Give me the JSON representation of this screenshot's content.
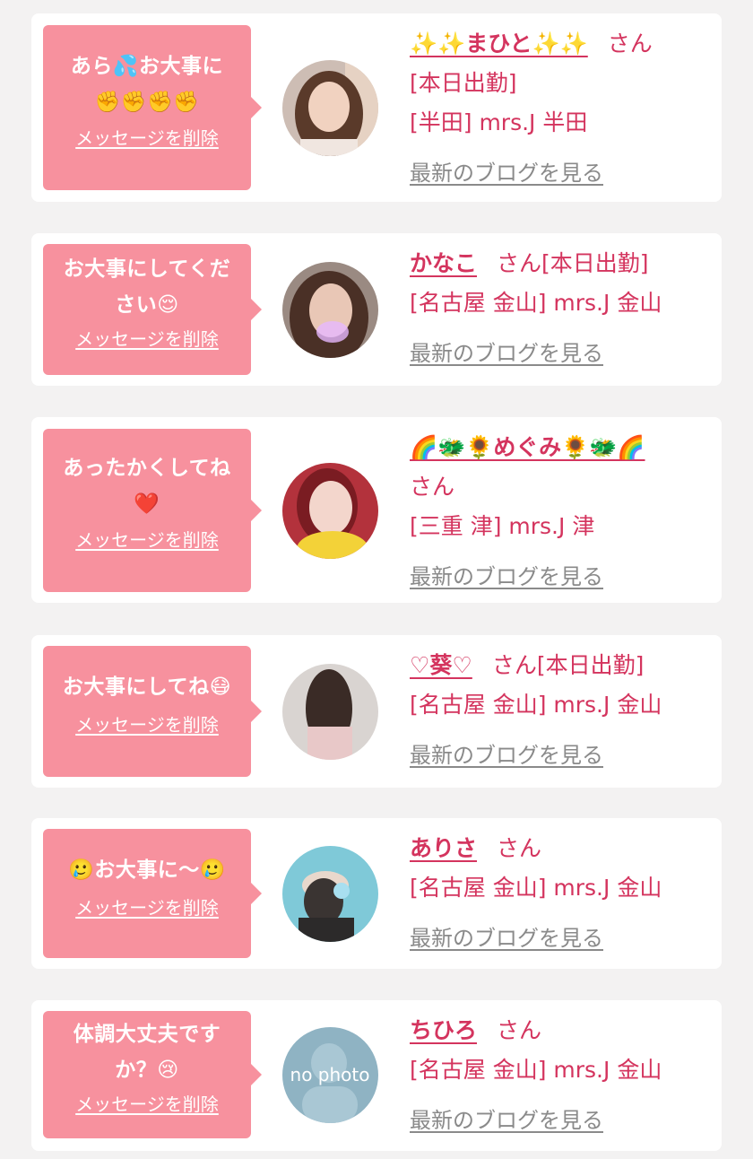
{
  "colors": {
    "background": "#f3f2f2",
    "card": "#ffffff",
    "bubble": "#f7919e",
    "name_text": "#d4345e",
    "blog_link": "#8a8a8a"
  },
  "common": {
    "delete_label": "メッセージを削除",
    "san_suffix": "さん",
    "blog_link_label": "最新のブログを見る"
  },
  "items": [
    {
      "message_line1": "あら💦お大事に",
      "message_line2": "✊✊✊✊",
      "cast_name": "✨✨まひと✨✨",
      "status": "[本日出勤]",
      "shop": "[半田] mrs.J 半田",
      "avatar_icon": "cast-photo"
    },
    {
      "message_line1": "お大事にしてくだ",
      "message_line2": "さい😌",
      "cast_name": "かなこ",
      "status": "[本日出勤]",
      "shop": "[名古屋 金山] mrs.J 金山",
      "avatar_icon": "cast-photo"
    },
    {
      "message_line1": "あったかくしてね",
      "message_line2": "❤️",
      "cast_name": "🌈🐲🌻めぐみ🌻🐲🌈",
      "status": "",
      "shop": "[三重 津] mrs.J 津",
      "avatar_icon": "cast-photo"
    },
    {
      "message_line1": "お大事にしてね😷",
      "message_line2": "",
      "cast_name": "♡葵♡",
      "status": "[本日出勤]",
      "shop": "[名古屋 金山] mrs.J 金山",
      "avatar_icon": "cast-photo"
    },
    {
      "message_line1": "🥲お大事に〜🥲",
      "message_line2": "",
      "cast_name": "ありさ",
      "status": "",
      "shop": "[名古屋 金山] mrs.J 金山",
      "avatar_icon": "cast-photo"
    },
    {
      "message_line1": "体調大丈夫です",
      "message_line2": "か？😢",
      "cast_name": "ちひろ",
      "status": "",
      "shop": "[名古屋 金山] mrs.J 金山",
      "avatar_icon": "no-photo-placeholder",
      "avatar_text": "no photo"
    }
  ]
}
